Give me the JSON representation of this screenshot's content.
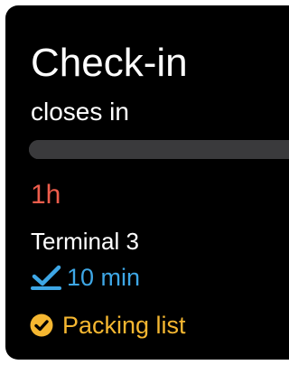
{
  "screen": {
    "title": "Check-in",
    "subtitle": "closes in",
    "progress": 1.0,
    "time_left": "1h",
    "terminal": "Terminal 3",
    "walk_time": "10 min",
    "packing_link": "Packing list"
  },
  "icons": {
    "walk": "checkmark-underline-icon",
    "packing": "check-circle-icon"
  },
  "colors": {
    "background": "#000000",
    "text": "#ffffff",
    "time_left": "#ee5d4c",
    "walk": "#3ea7e6",
    "packing": "#f5b731",
    "progress_track": "#3a3a3c",
    "progress_fill": "#3a3a3c"
  }
}
